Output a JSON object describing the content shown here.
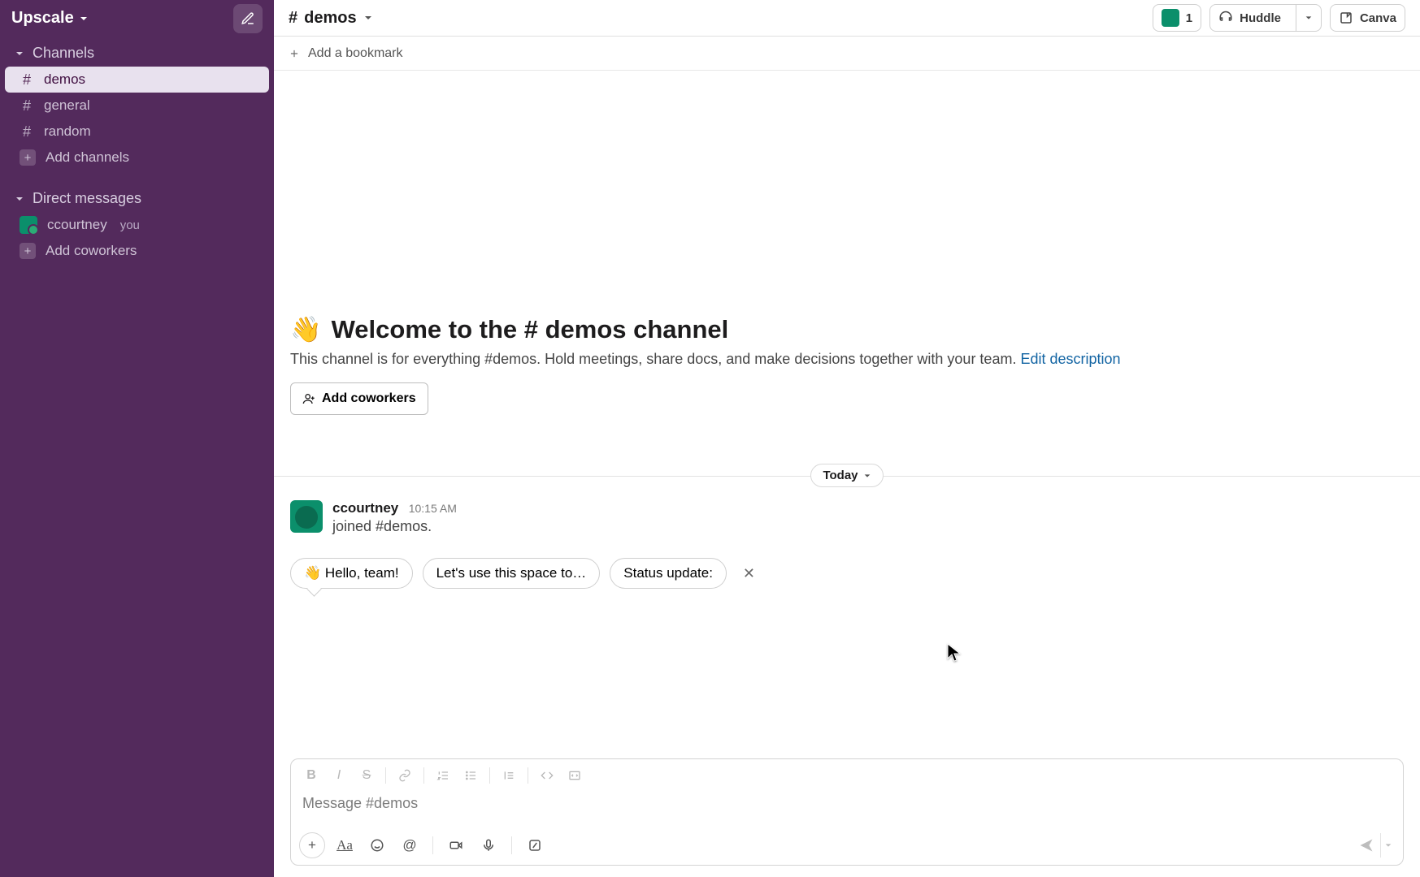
{
  "workspace": {
    "name": "Upscale"
  },
  "sidebar": {
    "channels_label": "Channels",
    "channels": [
      {
        "name": "demos",
        "active": true
      },
      {
        "name": "general",
        "active": false
      },
      {
        "name": "random",
        "active": false
      }
    ],
    "add_channels": "Add channels",
    "dm_label": "Direct messages",
    "dms": [
      {
        "name": "ccourtney",
        "you": "you"
      }
    ],
    "add_coworkers": "Add coworkers"
  },
  "header": {
    "channel_name": "demos",
    "member_count": "1",
    "huddle": "Huddle",
    "canvas": "Canva"
  },
  "bookmark": {
    "add": "Add a bookmark"
  },
  "welcome": {
    "title": "Welcome to the # demos channel",
    "emoji": "👋",
    "desc": "This channel is for everything #demos. Hold meetings, share docs, and make decisions together with your team. ",
    "edit": "Edit description",
    "add_coworkers": "Add coworkers"
  },
  "divider": {
    "label": "Today"
  },
  "messages": [
    {
      "user": "ccourtney",
      "time": "10:15 AM",
      "text": "joined #demos."
    }
  ],
  "suggestions": [
    "👋 Hello, team!",
    "Let's use this space to…",
    "Status update:"
  ],
  "composer": {
    "placeholder": "Message #demos"
  }
}
